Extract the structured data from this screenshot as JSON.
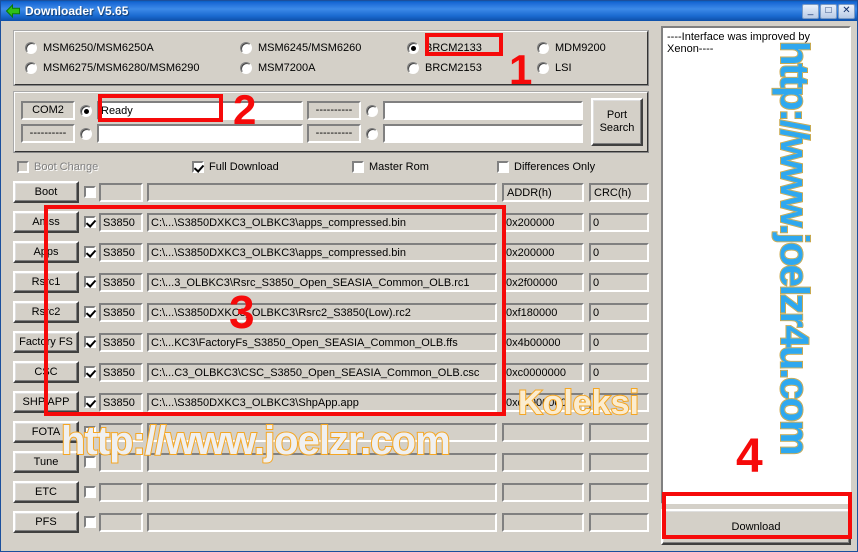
{
  "window": {
    "title": "Downloader V5.65",
    "icon": "back-arrow-icon",
    "minimize_label": "_",
    "maximize_label": "□",
    "close_label": "✕"
  },
  "chipset": {
    "options": [
      {
        "label": "MSM6250/MSM6250A",
        "selected": false
      },
      {
        "label": "MSM6245/MSM6260",
        "selected": false
      },
      {
        "label": "BRCM2133",
        "selected": true
      },
      {
        "label": "MDM9200",
        "selected": false
      },
      {
        "label": "MSM6275/MSM6280/MSM6290",
        "selected": false
      },
      {
        "label": "MSM7200A",
        "selected": false
      },
      {
        "label": "BRCM2153",
        "selected": false
      },
      {
        "label": "LSI",
        "selected": false
      }
    ]
  },
  "ports": {
    "rows": [
      {
        "combo": "COM2",
        "radio_selected": true,
        "status": "Ready"
      },
      {
        "combo": "----------",
        "radio_selected": false,
        "status": ""
      },
      {
        "combo": "----------",
        "radio_selected": false,
        "status": ""
      },
      {
        "combo": "----------",
        "radio_selected": false,
        "status": ""
      }
    ],
    "port_search_label": "Port\nSearch",
    "port_search_line1": "Port",
    "port_search_line2": "Search"
  },
  "options": {
    "boot_change": {
      "label": "Boot Change",
      "checked": false,
      "disabled": true
    },
    "full_download": {
      "label": "Full Download",
      "checked": true,
      "disabled": false
    },
    "master_rom": {
      "label": "Master Rom",
      "checked": false,
      "disabled": false
    },
    "differences_only": {
      "label": "Differences Only",
      "checked": false,
      "disabled": false
    }
  },
  "table": {
    "headers": {
      "addr": "ADDR(h)",
      "crc": "CRC(h)"
    },
    "rows": [
      {
        "button": "Boot",
        "checked": false,
        "version": "",
        "path": "",
        "addr": "",
        "crc": ""
      },
      {
        "button": "Amss",
        "checked": true,
        "version": "S3850",
        "path": "C:\\...\\S3850DXKC3_OLBKC3\\apps_compressed.bin",
        "addr": "0x200000",
        "crc": "0"
      },
      {
        "button": "Apps",
        "checked": true,
        "version": "S3850",
        "path": "C:\\...\\S3850DXKC3_OLBKC3\\apps_compressed.bin",
        "addr": "0x200000",
        "crc": "0"
      },
      {
        "button": "Rsrc1",
        "checked": true,
        "version": "S3850",
        "path": "C:\\...3_OLBKC3\\Rsrc_S3850_Open_SEASIA_Common_OLB.rc1",
        "addr": "0x2f00000",
        "crc": "0"
      },
      {
        "button": "Rsrc2",
        "checked": true,
        "version": "S3850",
        "path": "C:\\...\\S3850DXKC3_OLBKC3\\Rsrc2_S3850(Low).rc2",
        "addr": "0xf180000",
        "crc": "0"
      },
      {
        "button": "Factory FS",
        "checked": true,
        "version": "S3850",
        "path": "C:\\...KC3\\FactoryFs_S3850_Open_SEASIA_Common_OLB.ffs",
        "addr": "0x4b00000",
        "crc": "0"
      },
      {
        "button": "CSC",
        "checked": true,
        "version": "S3850",
        "path": "C:\\...C3_OLBKC3\\CSC_S3850_Open_SEASIA_Common_OLB.csc",
        "addr": "0xc0000000",
        "crc": "0"
      },
      {
        "button": "SHP APP",
        "checked": true,
        "version": "S3850",
        "path": "C:\\...\\S3850DXKC3_OLBKC3\\ShpApp.app",
        "addr": "0xd0000000",
        "crc": "0"
      },
      {
        "button": "FOTA",
        "checked": false,
        "version": "",
        "path": "",
        "addr": "",
        "crc": ""
      },
      {
        "button": "Tune",
        "checked": false,
        "version": "",
        "path": "",
        "addr": "",
        "crc": ""
      },
      {
        "button": "ETC",
        "checked": false,
        "version": "",
        "path": "",
        "addr": "",
        "crc": ""
      },
      {
        "button": "PFS",
        "checked": false,
        "version": "",
        "path": "",
        "addr": "",
        "crc": ""
      }
    ]
  },
  "log": {
    "message": "----Interface was improved by Xenon----"
  },
  "download": {
    "label": "Download"
  },
  "annotations": {
    "marker1": "1",
    "marker2": "2",
    "marker3": "3",
    "marker4": "4",
    "color": "#f60a0a"
  },
  "watermarks": {
    "vertical": "http://www.joelzr4u.com",
    "horizontal": "http://www.joelzr.com",
    "badge": "Koleksi"
  }
}
